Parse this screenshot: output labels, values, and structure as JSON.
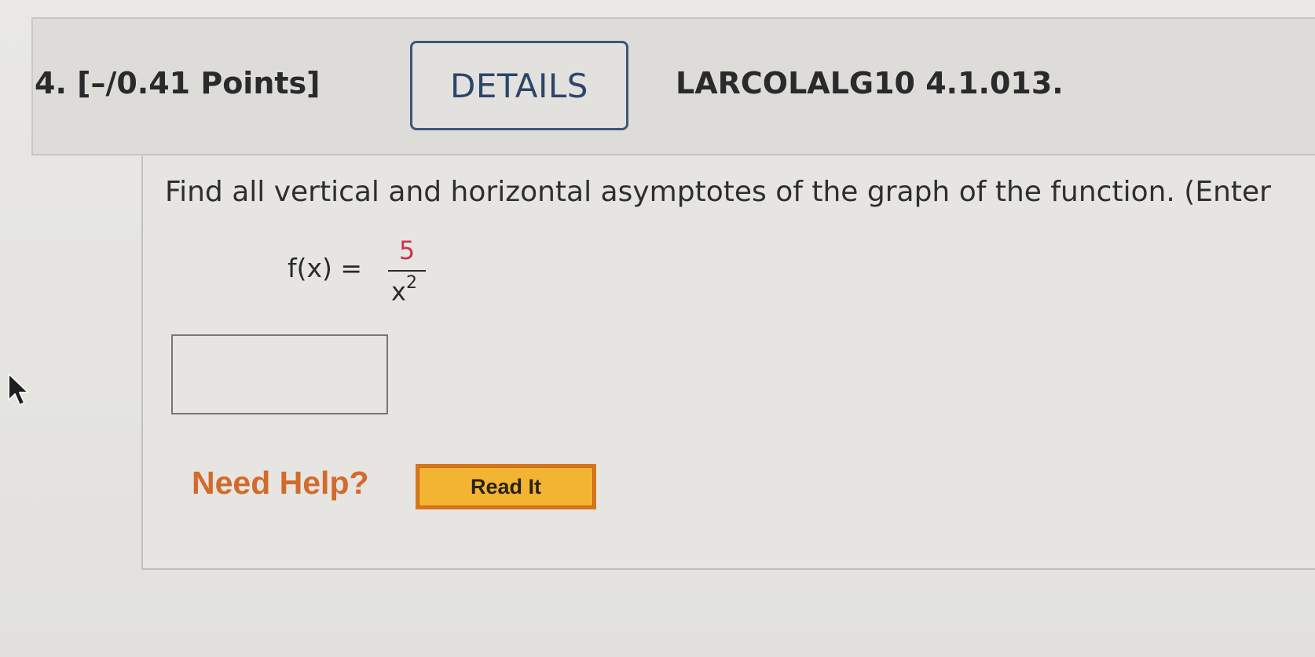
{
  "question": {
    "number_points": "4.  [–/0.41 Points]",
    "details_label": "DETAILS",
    "source_code": "LARCOLALG10 4.1.013."
  },
  "body": {
    "instructions": "Find all vertical and horizontal asymptotes of the graph of the function. (Enter",
    "function_lhs": "f(x) =",
    "numerator": "5",
    "denominator_base": "x",
    "denominator_exponent": "2",
    "answer_value": ""
  },
  "help": {
    "need_help_label": "Need Help?",
    "read_it_label": "Read It"
  },
  "colors": {
    "details_border": "#3f5777",
    "numerator": "#c8344a",
    "need_help": "#d26a2c",
    "read_it_fill": "#f3b434",
    "read_it_border": "#d8761c"
  },
  "icons": {
    "cursor": "mouse-pointer-icon"
  }
}
